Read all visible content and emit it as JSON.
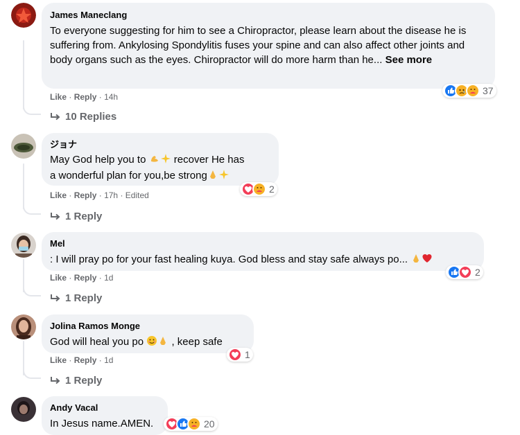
{
  "comments": [
    {
      "author": "James Maneclang",
      "text": "To everyone suggesting for him to see a Chiropractor, please learn about the disease he is suffering from. Ankylosing Spondylitis fuses your spine and can also affect other joints and body organs such as the eyes. Chiropractor will do more harm than he...",
      "see_more": "See more",
      "like": "Like",
      "reply": "Reply",
      "time": "14h",
      "edited": "",
      "reaction_count": "37",
      "reaction_icons": [
        "like-icon",
        "sad-icon",
        "care-icon"
      ],
      "replies": "10 Replies"
    },
    {
      "author": "ジョナ",
      "text_line1": "May God help you to",
      "text_line1b": "recover He has",
      "text_line2": "a wonderful plan for you,be strong",
      "like": "Like",
      "reply": "Reply",
      "time": "17h",
      "edited": "Edited",
      "reaction_count": "2",
      "reaction_icons": [
        "love-icon",
        "care-icon"
      ],
      "replies": "1 Reply"
    },
    {
      "author": "Mel",
      "text": ": I will pray po for your fast healing kuya. God bless and stay safe always po...",
      "like": "Like",
      "reply": "Reply",
      "time": "1d",
      "reaction_count": "2",
      "reaction_icons": [
        "like-icon",
        "love-icon"
      ],
      "replies": "1 Reply"
    },
    {
      "author": "Jolina Ramos Monge",
      "text": "God will heal you po",
      "text_after": ", keep safe",
      "like": "Like",
      "reply": "Reply",
      "time": "1d",
      "reaction_count": "1",
      "reaction_icons": [
        "love-icon"
      ],
      "replies": "1 Reply"
    },
    {
      "author": "Andy Vacal",
      "text": "In Jesus name.AMEN.",
      "reaction_count": "20",
      "reaction_icons": [
        "love-icon",
        "like-icon",
        "care-icon"
      ]
    }
  ],
  "sep": "·",
  "colors": {
    "bubble": "#f0f2f5",
    "meta": "#65676b",
    "like": "#1877f2",
    "love": "#f33e58",
    "care": "#f7b125"
  }
}
